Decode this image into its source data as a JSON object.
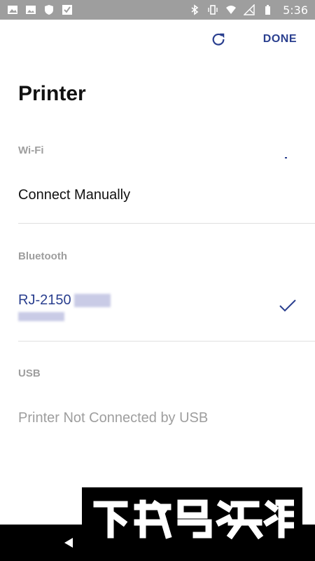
{
  "status_bar": {
    "time": "5:36",
    "left_icons": [
      "gallery-icon",
      "image-icon",
      "shield-icon",
      "check-icon"
    ],
    "right_icons": [
      "bluetooth-icon",
      "vibrate-icon",
      "wifi-icon",
      "no-signal-icon",
      "battery-icon"
    ]
  },
  "toolbar": {
    "done_label": "DONE",
    "refresh_icon": "refresh-icon"
  },
  "page": {
    "title": "Printer"
  },
  "sections": {
    "wifi": {
      "label": "Wi-Fi",
      "item": "Connect Manually"
    },
    "bluetooth": {
      "label": "Bluetooth",
      "device_name": "RJ-2150",
      "selected": true
    },
    "usb": {
      "label": "USB",
      "status": "Printer Not Connected by USB"
    }
  },
  "colors": {
    "accent": "#2a3f8f",
    "muted": "#9e9e9e",
    "text": "#111111"
  },
  "watermark": {
    "image_name": "logo-watermark"
  }
}
